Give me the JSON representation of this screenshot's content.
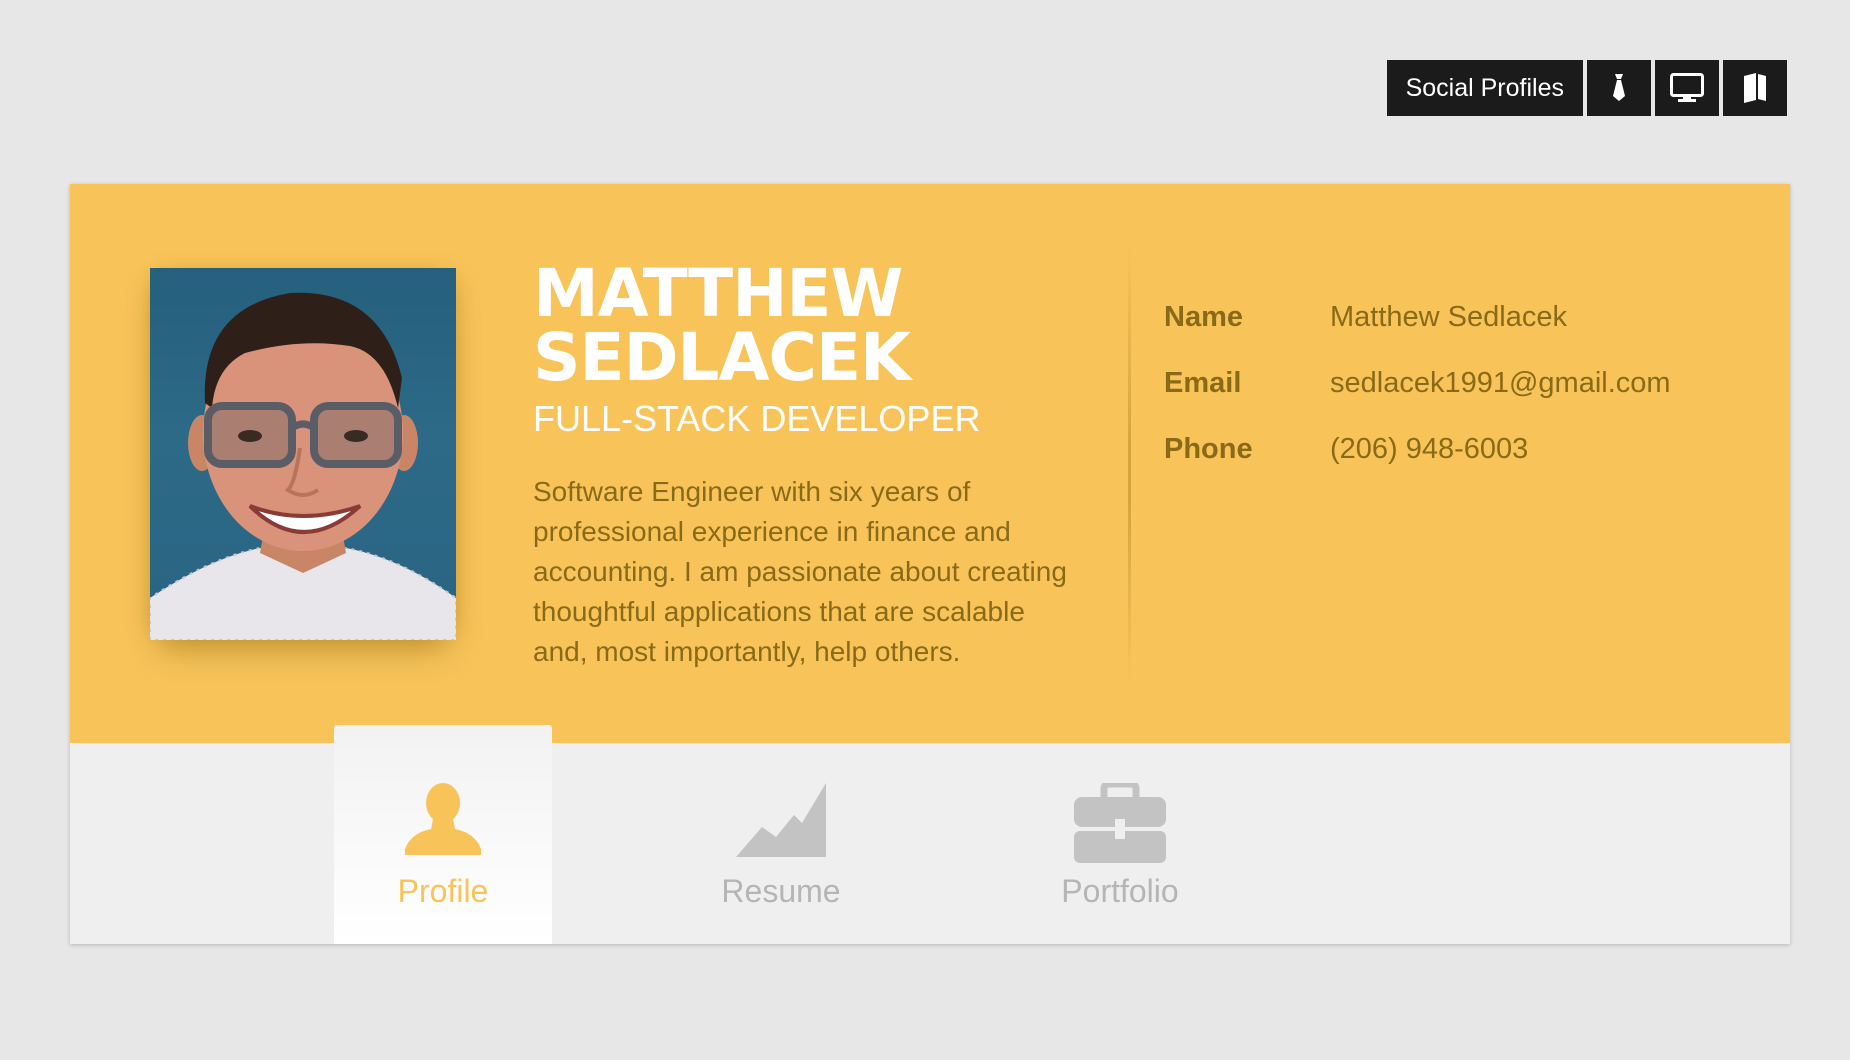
{
  "social": {
    "label": "Social Profiles",
    "buttons": [
      {
        "icon": "tie-icon"
      },
      {
        "icon": "monitor-icon"
      },
      {
        "icon": "book-icon"
      }
    ]
  },
  "profile": {
    "first_name": "MATTHEW",
    "last_name": "SEDLACEK",
    "title": "FULL-STACK DEVELOPER",
    "bio": "Software Engineer with six years of professional experience in finance and accounting. I am passionate about creating thoughtful applications that are scalable and, most importantly, help others."
  },
  "contact": [
    {
      "key": "Name",
      "value": "Matthew Sedlacek"
    },
    {
      "key": "Email",
      "value": "sedlacek1991@gmail.com"
    },
    {
      "key": "Phone",
      "value": "(206) 948-6003"
    }
  ],
  "tabs": [
    {
      "label": "Profile",
      "icon": "person-icon",
      "active": true
    },
    {
      "label": "Resume",
      "icon": "chart-icon",
      "active": false
    },
    {
      "label": "Portfolio",
      "icon": "briefcase-icon",
      "active": false
    }
  ],
  "colors": {
    "accent": "#f8c45a",
    "text_dark": "#8a6a16",
    "inactive_tab": "#b5b5b5",
    "social_bg": "#1b1b1b"
  }
}
